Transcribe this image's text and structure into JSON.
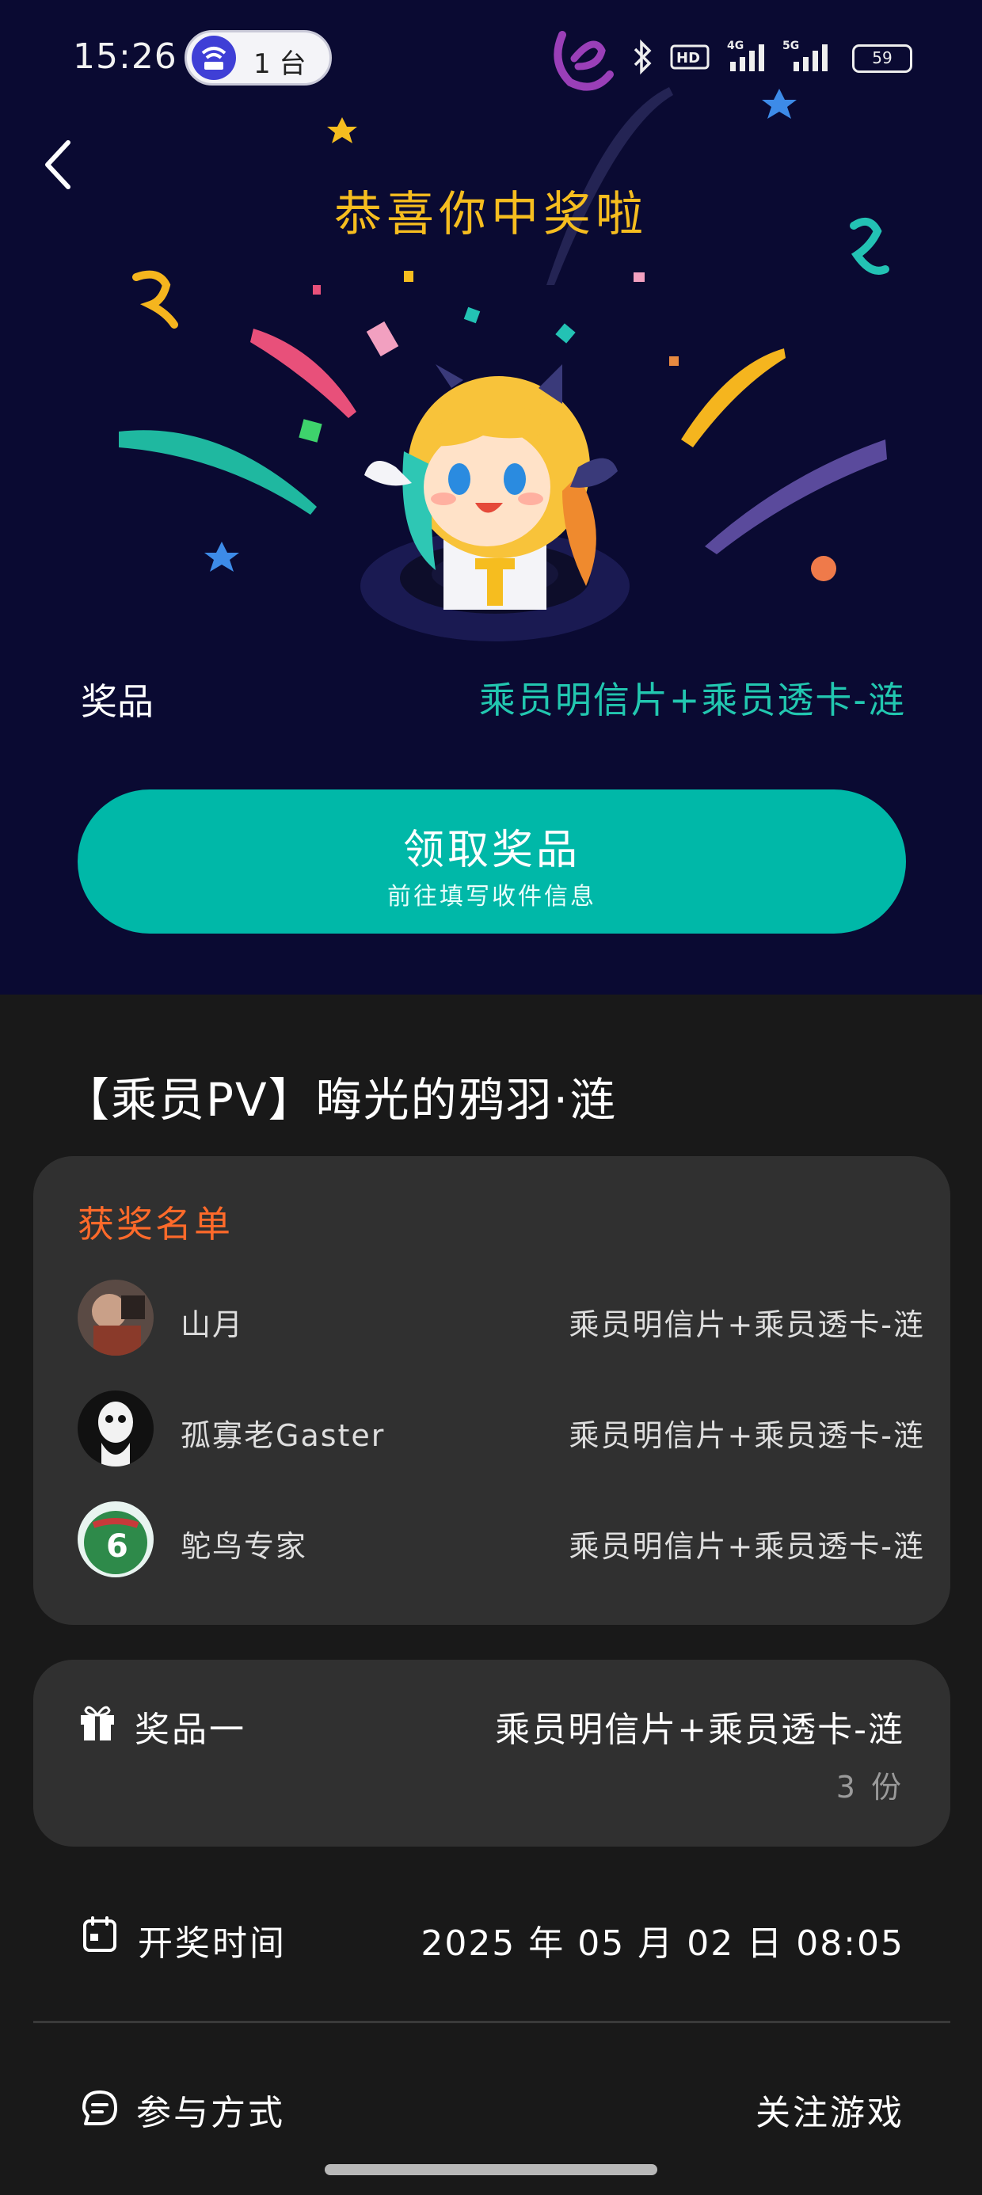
{
  "status_bar": {
    "time": "15:26",
    "hotspot_label": "1 台",
    "battery": "59",
    "network_labels": [
      "HD",
      "4G",
      "5G"
    ]
  },
  "hero": {
    "title": "恭喜你中奖啦",
    "prize_label": "奖品",
    "prize_value": "乘员明信片+乘员透卡-涟",
    "claim_button": {
      "main": "领取奖品",
      "sub": "前往填写收件信息"
    }
  },
  "event": {
    "title": "【乘员PV】晦光的鸦羽·涟"
  },
  "winners": {
    "title": "获奖名单",
    "list": [
      {
        "name": "山月",
        "prize": "乘员明信片+乘员透卡-涟"
      },
      {
        "name": "孤寡老Gaster",
        "prize": "乘员明信片+乘员透卡-涟"
      },
      {
        "name": "鸵鸟专家",
        "prize": "乘员明信片+乘员透卡-涟"
      }
    ]
  },
  "prize_detail": {
    "tier": "奖品一",
    "name": "乘员明信片+乘员透卡-涟",
    "quantity": "3 份"
  },
  "draw": {
    "label": "开奖时间",
    "time": "2025 年 05 月 02 日 08:05"
  },
  "footer": {
    "participate": "参与方式",
    "follow": "关注游戏"
  },
  "colors": {
    "hero_bg": "#0a0a32",
    "page_bg": "#191919",
    "card_bg": "#303030",
    "accent_teal": "#00b8a8",
    "prize_teal": "#22c7b0",
    "title_gold": "#f6bd1f",
    "winners_orange": "#ff6a2a"
  }
}
